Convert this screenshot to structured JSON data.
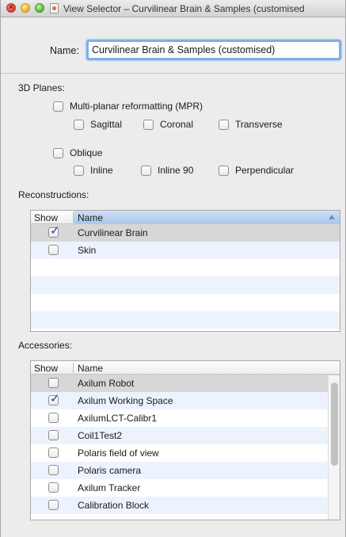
{
  "window": {
    "title": "View Selector – Curvilinear Brain & Samples (customised"
  },
  "name": {
    "label": "Name:",
    "value": "Curvilinear Brain & Samples (customised)"
  },
  "planes": {
    "label": "3D Planes:",
    "mpr": {
      "label": "Multi-planar reformatting (MPR)",
      "checked": false
    },
    "sagittal": {
      "label": "Sagittal",
      "checked": false
    },
    "coronal": {
      "label": "Coronal",
      "checked": false
    },
    "transverse": {
      "label": "Transverse",
      "checked": false
    },
    "oblique": {
      "label": "Oblique",
      "checked": false
    },
    "inline": {
      "label": "Inline",
      "checked": false
    },
    "inline90": {
      "label": "Inline 90",
      "checked": false
    },
    "perpendicular": {
      "label": "Perpendicular",
      "checked": false
    }
  },
  "reconstructions": {
    "label": "Reconstructions:",
    "col_show": "Show",
    "col_name": "Name",
    "rows": [
      {
        "name": "Curvilinear Brain",
        "checked": true
      },
      {
        "name": "Skin",
        "checked": false
      }
    ]
  },
  "accessories": {
    "label": "Accessories:",
    "col_show": "Show",
    "col_name": "Name",
    "rows": [
      {
        "name": "Axilum Robot",
        "checked": false
      },
      {
        "name": "Axilum Working Space",
        "checked": true
      },
      {
        "name": "AxilumLCT-Calibr1",
        "checked": false
      },
      {
        "name": "Coil1Test2",
        "checked": false
      },
      {
        "name": "Polaris field of view",
        "checked": false
      },
      {
        "name": "Polaris camera",
        "checked": false
      },
      {
        "name": "Axilum Tracker",
        "checked": false
      },
      {
        "name": "Calibration Block",
        "checked": false
      }
    ]
  },
  "checkmark": "✓"
}
